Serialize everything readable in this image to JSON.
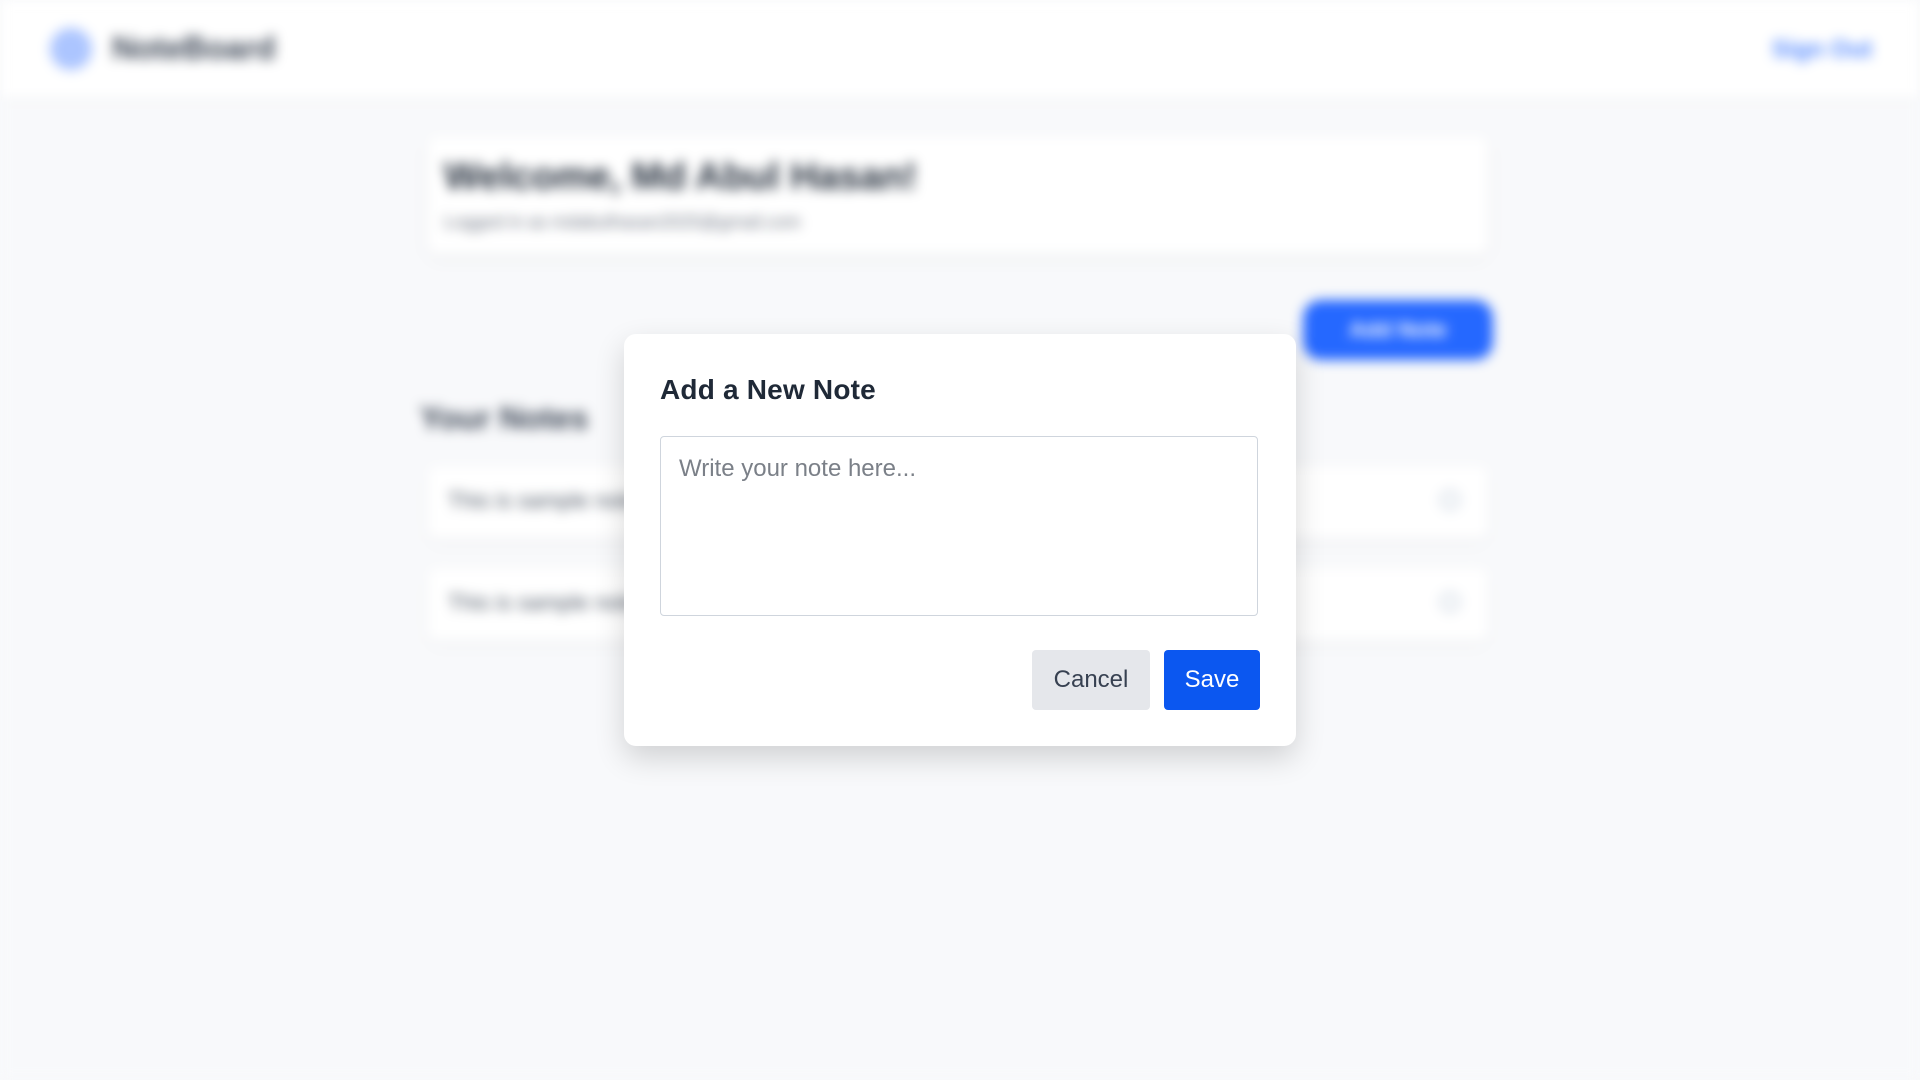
{
  "background": {
    "brand": "NoteBoard",
    "sign_out": "Sign Out",
    "welcome_title": "Welcome, Md Abul Hasan!",
    "welcome_subtitle": "Logged in as mdabulhasan2025@gmail.com",
    "add_note_button": "Add Note",
    "notes_heading": "Your Notes",
    "notes": [
      "This is sample note one",
      "This is sample note two"
    ]
  },
  "modal": {
    "title": "Add a New Note",
    "note_placeholder": "Write your note here...",
    "note_value": "",
    "cancel_label": "Cancel",
    "save_label": "Save"
  },
  "colors": {
    "primary": "#0b57f0",
    "muted_button": "#e5e7eb",
    "page_background": "#f8f9fb",
    "title_text": "#1f2937"
  },
  "icons": [
    "logo-icon",
    "note-options-icon"
  ]
}
